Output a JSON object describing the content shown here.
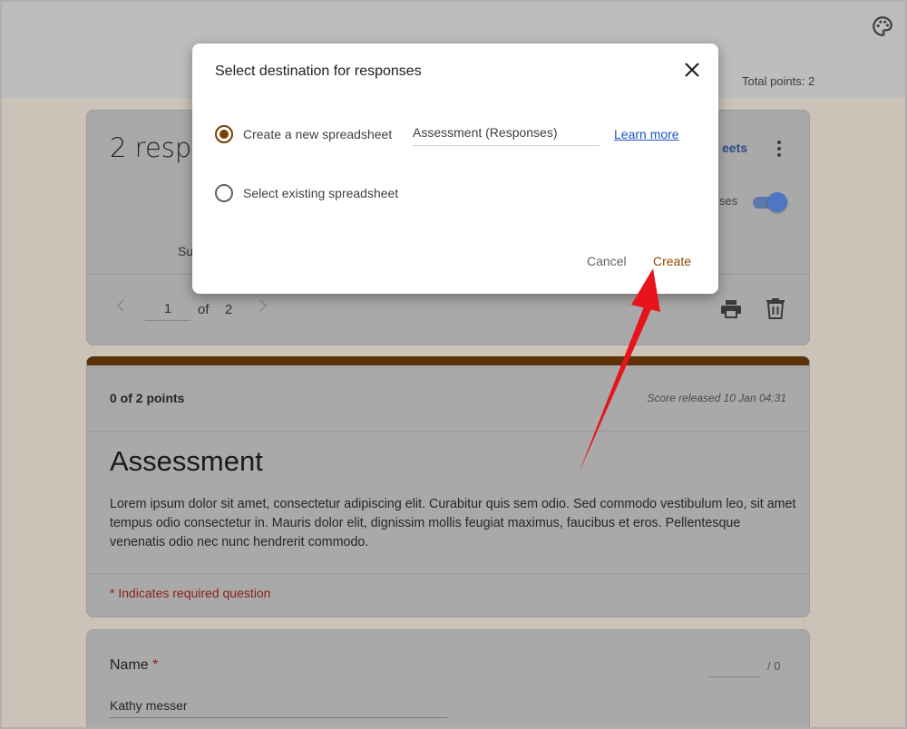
{
  "header": {
    "total_points": "Total points: 2",
    "palette_icon": "palette-icon"
  },
  "responses_card": {
    "title": "2 respo",
    "sheets_link": "eets",
    "accepting_label": "ses",
    "summary_tab": "Su",
    "pager": {
      "current": "1",
      "of": "of",
      "total": "2"
    }
  },
  "score_card": {
    "points": "0 of 2 points",
    "released": "Score released 10 Jan 04:31",
    "form_title": "Assessment",
    "description": "Lorem ipsum dolor sit amet, consectetur adipiscing elit. Curabitur quis sem odio. Sed commodo vestibulum leo, sit amet tempus odio consectetur in. Mauris dolor elit, dignissim mollis feugiat maximus, faucibus et eros. Pellentesque venenatis odio nec nunc hendrerit commodo.",
    "required_note": "* Indicates required question"
  },
  "name_question": {
    "label": "Name",
    "required_star": "*",
    "points_max": "/ 0",
    "answer": "Kathy messer"
  },
  "dialog": {
    "title": "Select destination for responses",
    "option_new": "Create a new spreadsheet",
    "sheet_name": "Assessment (Responses)",
    "learn_more": "Learn more",
    "option_existing": "Select existing spreadsheet",
    "cancel": "Cancel",
    "create": "Create",
    "selected_option": "new"
  },
  "colors": {
    "accent": "#7a3e00",
    "arrow": "#e8141c",
    "link": "#1a56c4"
  }
}
